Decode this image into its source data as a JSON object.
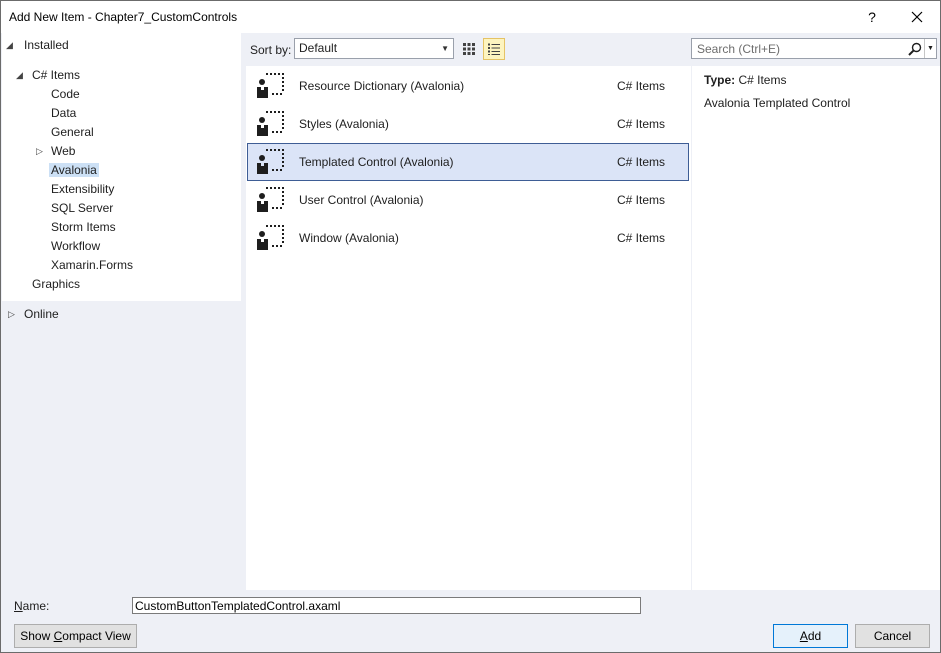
{
  "window": {
    "title": "Add New Item - Chapter7_CustomControls",
    "help_glyph": "?",
    "close_glyph": "✕"
  },
  "tree": {
    "installed": "Installed",
    "csharp_items": "C# Items",
    "children": [
      "Code",
      "Data",
      "General",
      "Web",
      "Avalonia",
      "Extensibility",
      "SQL Server",
      "Storm Items",
      "Workflow",
      "Xamarin.Forms"
    ],
    "graphics": "Graphics",
    "online": "Online",
    "selected": "Avalonia"
  },
  "sort": {
    "label": "Sort by:",
    "value": "Default"
  },
  "items": [
    {
      "name": "Resource Dictionary (Avalonia)",
      "category": "C# Items"
    },
    {
      "name": "Styles (Avalonia)",
      "category": "C# Items"
    },
    {
      "name": "Templated Control (Avalonia)",
      "category": "C# Items"
    },
    {
      "name": "User Control (Avalonia)",
      "category": "C# Items"
    },
    {
      "name": "Window (Avalonia)",
      "category": "C# Items"
    }
  ],
  "selected_item_index": 2,
  "search": {
    "placeholder": "Search (Ctrl+E)"
  },
  "detail": {
    "type_label": "Type:",
    "type_value": "C# Items",
    "description": "Avalonia Templated Control"
  },
  "name_field": {
    "label_prefix": "",
    "label_mnemonic": "N",
    "label_rest": "ame:",
    "value": "CustomButtonTemplatedControl.axaml"
  },
  "buttons": {
    "compact_prefix": "Show ",
    "compact_mnemonic": "C",
    "compact_rest": "ompact View",
    "add_mnemonic": "A",
    "add_rest": "dd",
    "cancel": "Cancel"
  },
  "colors": {
    "selection_bg": "#dbe4f7",
    "selection_border": "#3e5d95",
    "tree_selection": "#cce0f5",
    "panel_bg": "#eef0f6"
  }
}
